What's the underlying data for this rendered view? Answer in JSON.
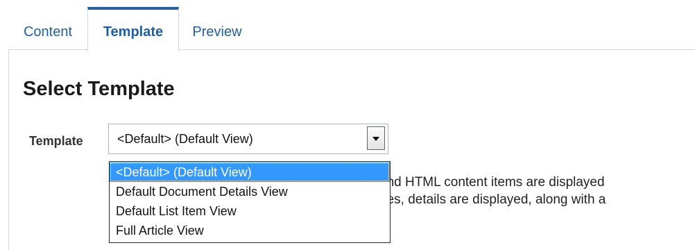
{
  "tabs": [
    {
      "label": "Content",
      "active": false
    },
    {
      "label": "Template",
      "active": true
    },
    {
      "label": "Preview",
      "active": false
    }
  ],
  "panel": {
    "heading": "Select Template",
    "template_field": {
      "label": "Template",
      "selected_value": "<Default> (Default View)",
      "options": [
        "<Default> (Default View)",
        "Default Document Details View",
        "Default List Item View",
        "Full Article View"
      ],
      "selected_index": 0,
      "expanded": true
    },
    "description_lines": [
      "and HTML content items are displayed",
      "pes, details are displayed, along with a"
    ]
  },
  "colors": {
    "accent": "#1f5fa6",
    "selection": "#3399ff",
    "border": "#cfd6dd"
  },
  "icons": {
    "dropdown_button": "chevron-down-icon"
  }
}
